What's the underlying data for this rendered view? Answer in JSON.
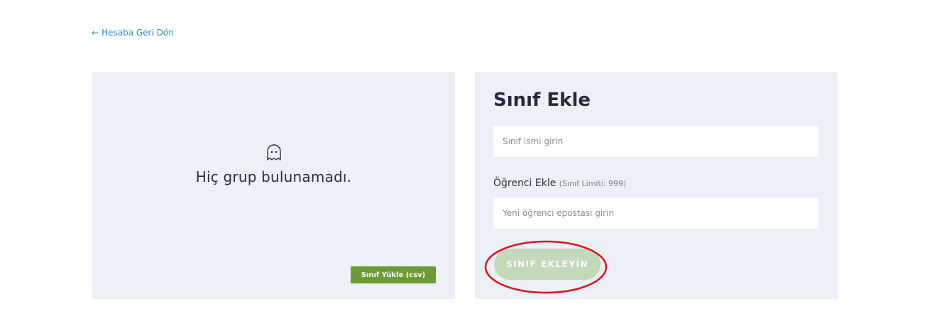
{
  "nav": {
    "back_label": "Hesaba Geri Dön"
  },
  "groups_panel": {
    "empty_message": "Hiç grup bulunamadı.",
    "upload_button_label": "Sınıf Yükle (csv)",
    "empty_icon": "ghost-icon"
  },
  "add_class_form": {
    "title": "Sınıf Ekle",
    "class_name_placeholder": "Sınıf ismi girin",
    "class_name_value": "",
    "student_label": "Öğrenci Ekle",
    "student_limit_note": "(Sınıf Limiti: 999)",
    "student_email_placeholder": "Yeni öğrenci epostası girin",
    "student_email_value": "",
    "submit_label": "SINIF EKLEYİN"
  },
  "colors": {
    "link": "#2b8cc4",
    "panel_bg": "#edf0f7",
    "upload_button": "#6c9a33",
    "submit_button_disabled": "#c3d9bb",
    "highlight_ring": "#e0131b"
  }
}
